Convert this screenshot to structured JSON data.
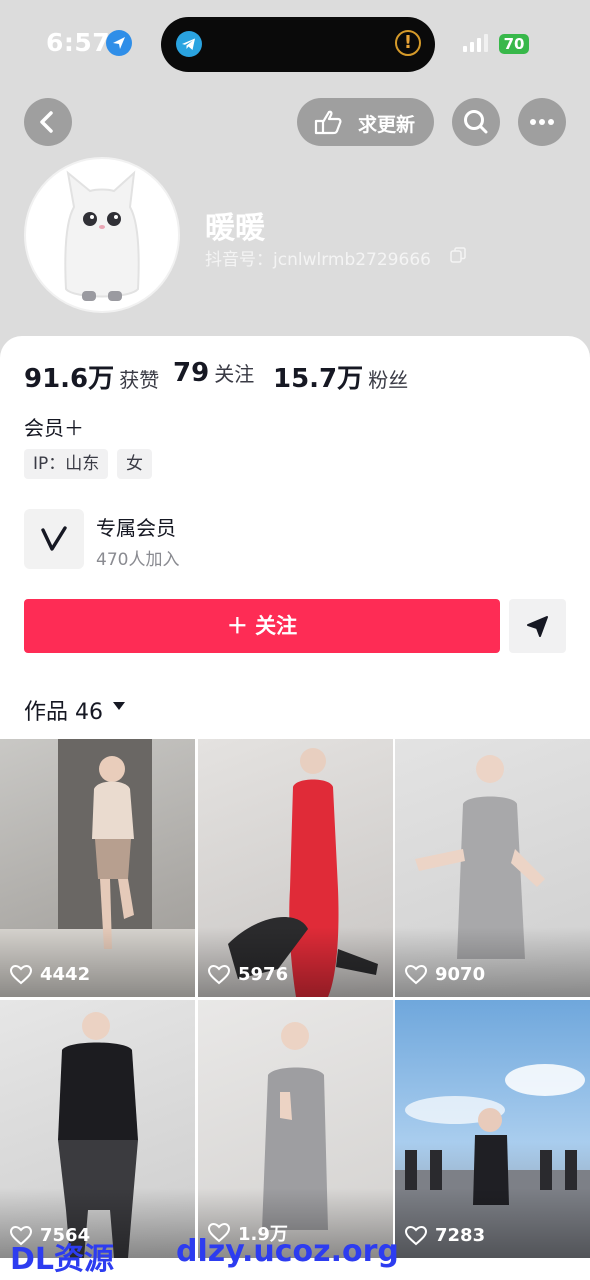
{
  "status_bar": {
    "time": "6:57",
    "battery": "70",
    "warning": "!"
  },
  "header": {
    "update_label": "求更新",
    "icons": [
      "back-icon",
      "hand-pointer-icon",
      "search-icon",
      "more-icon"
    ]
  },
  "profile": {
    "nickname": "暖暖",
    "douyin_id": "抖音号：jcnlwlrmb2729666"
  },
  "stats": [
    {
      "value": "91.6万",
      "label": "获赞"
    },
    {
      "value": "79",
      "label": "关注"
    },
    {
      "value": "15.7万",
      "label": "粉丝"
    }
  ],
  "membership": "会员＋",
  "tags": [
    "IP：山东",
    "女"
  ],
  "club": {
    "title": "专属会员",
    "count": "470人加入"
  },
  "follow_button": "＋ 关注",
  "works": {
    "label": "作品 46"
  },
  "videos": [
    {
      "likes": "4442"
    },
    {
      "likes": "5976"
    },
    {
      "likes": "9070"
    },
    {
      "likes": "7564"
    },
    {
      "likes": "1.9万"
    },
    {
      "likes": "7283"
    }
  ],
  "watermark": {
    "left": "DL资源",
    "right": "dlzy.ucoz.org"
  },
  "colors": {
    "accent": "#fe2c55",
    "header_bg": "#dcdcdc"
  }
}
